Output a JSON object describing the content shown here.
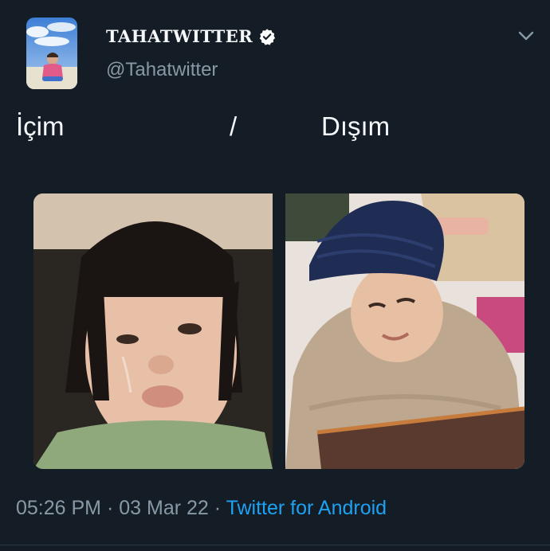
{
  "tweet": {
    "author": {
      "display_name": "TAHATWITTER",
      "handle": "@Tahatwitter",
      "verified": true,
      "avatar_icon": "profile-photo"
    },
    "menu_icon": "chevron-down-icon",
    "text_parts": [
      "İçim",
      "/",
      "Dışım"
    ],
    "media": [
      {
        "icon": "photo-crying-toddler-bob-haircut"
      },
      {
        "icon": "photo-smiling-toddler-beanie-fur-coat"
      }
    ],
    "time": "05:26 PM",
    "separator": "·",
    "date": "03 Mar 22",
    "source": "Twitter for Android"
  },
  "colors": {
    "background": "#141d26",
    "text_primary": "#f5f8fa",
    "text_secondary": "#8899a6",
    "link": "#1da1f2",
    "verified_badge": "#ffffff"
  }
}
